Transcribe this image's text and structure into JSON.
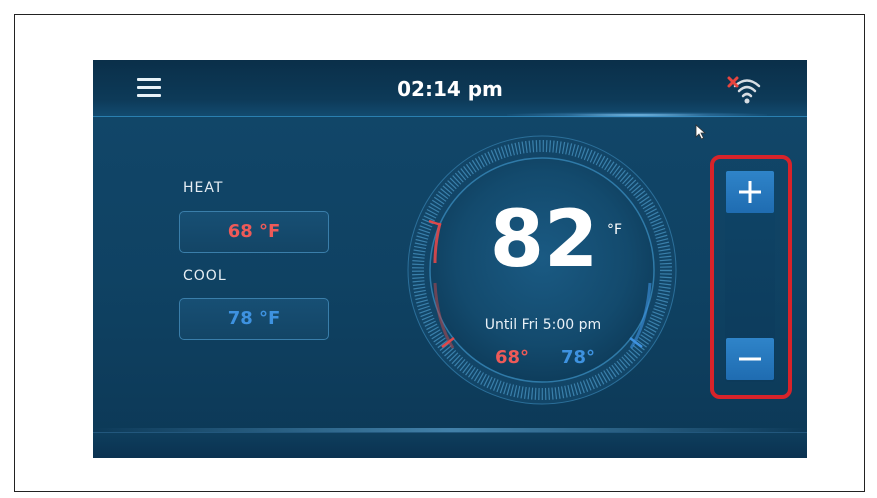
{
  "header": {
    "time": "02:14 pm"
  },
  "status": {
    "wifi_state": "disconnected",
    "icons": [
      "menu-icon",
      "wifi-off-icon",
      "plus-icon",
      "minus-icon",
      "pointer-cursor-icon"
    ]
  },
  "left_panel": {
    "heat": {
      "label": "HEAT",
      "value": "68 °F"
    },
    "cool": {
      "label": "COOL",
      "value": "78 °F"
    }
  },
  "dial": {
    "current_temp": "82",
    "unit": "°F",
    "schedule": "Until Fri 5:00 pm",
    "heat_setpoint": "68°",
    "cool_setpoint": "78°"
  },
  "colors": {
    "heat": "#ee5a58",
    "cool": "#3e92e0",
    "background": "#12476a",
    "highlight": "#d8232a"
  }
}
